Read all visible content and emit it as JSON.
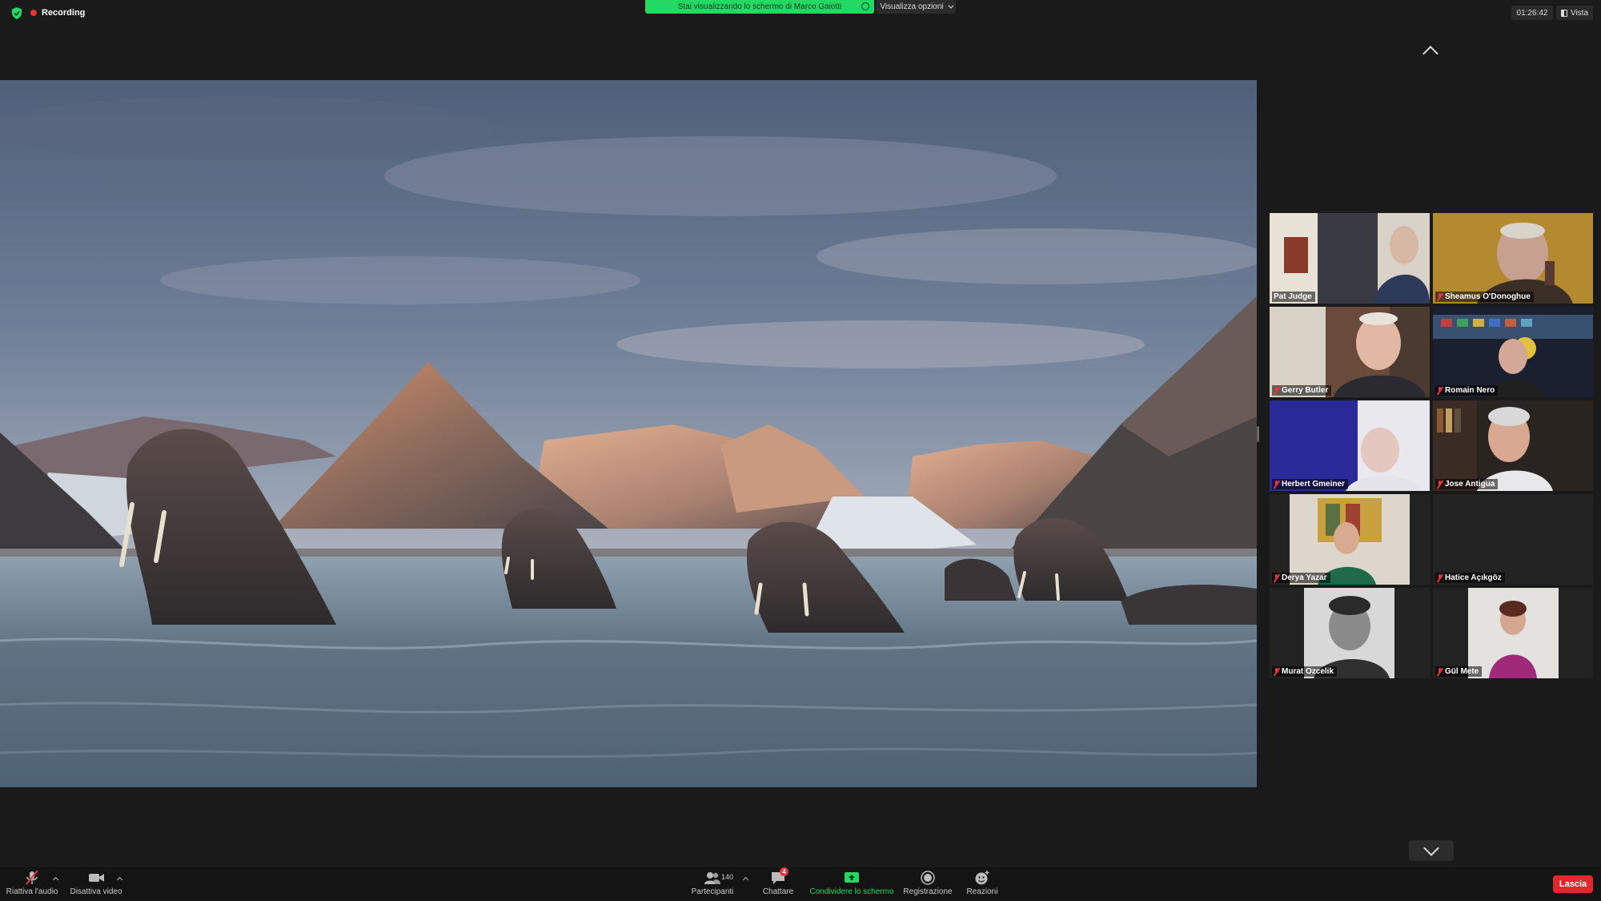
{
  "top_bar": {
    "recording_label": "Recording",
    "share_banner": "Stai visualizzando lo schermo di Marco Gaiotti",
    "view_options_label": "Visualizza opzioni",
    "clock": "01:26:42",
    "view_label": "Vista"
  },
  "shared_screen": {
    "content": "Walrus photograph"
  },
  "participants": [
    {
      "name": "Pat Judge",
      "muted": false
    },
    {
      "name": "Sheamus O'Donoghue",
      "muted": true
    },
    {
      "name": "Gerry Butler",
      "muted": true
    },
    {
      "name": "Romain Nero",
      "muted": true
    },
    {
      "name": "Herbert Gmeiner",
      "muted": true
    },
    {
      "name": "Jose Antigua",
      "muted": true
    },
    {
      "name": "Derya Yazar",
      "muted": true
    },
    {
      "name": "Hatice Açıkgöz",
      "muted": true
    },
    {
      "name": "Murat Ozcelik",
      "muted": true
    },
    {
      "name": "Gül Mete",
      "muted": true
    }
  ],
  "toolbar": {
    "audio_label": "Riattiva l'audio",
    "video_label": "Disattiva video",
    "participants_label": "Partecipanti",
    "participants_count": "140",
    "chat_label": "Chattare",
    "chat_badge": "4",
    "share_label": "Condividere lo schermo",
    "record_label": "Registrazione",
    "reactions_label": "Reazioni",
    "leave_label": "Lascia"
  },
  "colors": {
    "share_green": "#23d962",
    "leave_red": "#e0282e",
    "mute_red": "#e8343a",
    "background": "#1a1a1a"
  }
}
